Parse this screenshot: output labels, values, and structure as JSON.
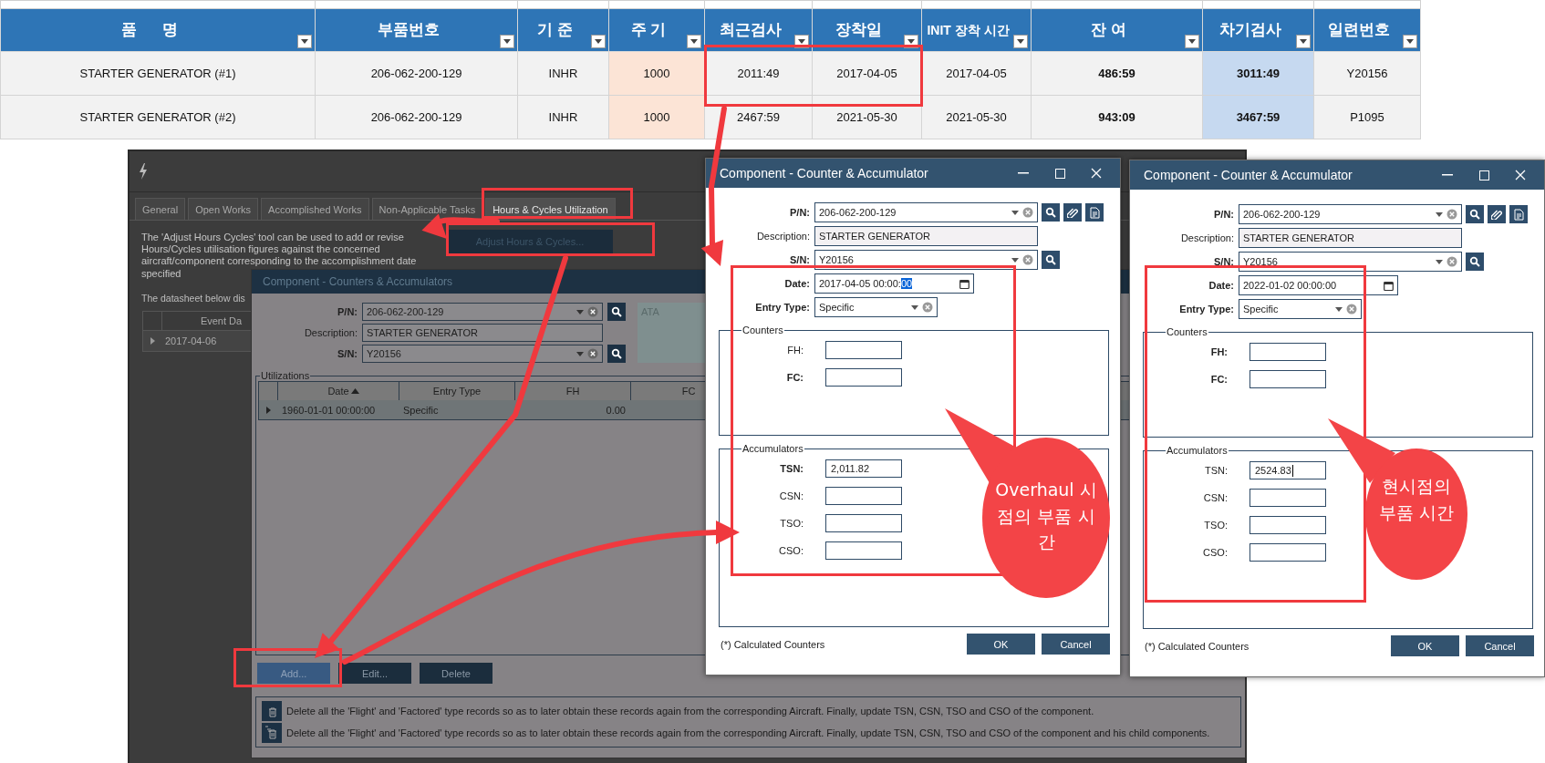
{
  "sheet": {
    "columns": [
      {
        "label": "품      명",
        "kind": "plain",
        "bold": false
      },
      {
        "label": "부품번호",
        "kind": "plain",
        "bold": false
      },
      {
        "label": "기 준",
        "kind": "plain",
        "bold": false
      },
      {
        "label": "주 기",
        "kind": "interval",
        "bold": false
      },
      {
        "label": "최근검사",
        "kind": "plain",
        "bold": false
      },
      {
        "label": "장착일",
        "kind": "plain",
        "bold": false
      },
      {
        "label": "INIT 장착 시간",
        "kind": "plain",
        "bold": false
      },
      {
        "label": "잔 여",
        "kind": "plain",
        "bold": true
      },
      {
        "label": "차기검사",
        "kind": "next",
        "bold": true
      },
      {
        "label": "일련번호",
        "kind": "plain",
        "bold": false
      }
    ],
    "rows": [
      {
        "cells": [
          "STARTER GENERATOR (#1)",
          "206-062-200-129",
          "INHR",
          "1000",
          "2011:49",
          "2017-04-05",
          "2017-04-05",
          "486:59",
          "3011:49",
          "Y20156"
        ]
      },
      {
        "cells": [
          "STARTER GENERATOR (#2)",
          "206-062-200-129",
          "INHR",
          "1000",
          "2467:59",
          "2021-05-30",
          "2021-05-30",
          "943:09",
          "3467:59",
          "P1095"
        ]
      }
    ]
  },
  "main_window": {
    "tabs": [
      {
        "label": "General",
        "selected": false
      },
      {
        "label": "Open Works",
        "selected": false
      },
      {
        "label": "Accomplished  Works",
        "selected": false
      },
      {
        "label": "Non-Applicable Tasks",
        "selected": false
      },
      {
        "label": "Hours & Cycles Utilization",
        "selected": true
      }
    ],
    "intro": "The 'Adjust Hours  Cycles' tool can be used to add or revise Hours/Cycles utilisation figures against the concerned aircraft/component corresponding to the accomplishment date specified",
    "adjust_button": "Adjust Hours & Cycles...",
    "datasheet_note": "The datasheet below dis",
    "grid_column": "Event Da",
    "grid_rows": [
      "2017-04-06"
    ]
  },
  "counters_dialog": {
    "title": "Component - Counters & Accumulators",
    "pn_label": "P/N:",
    "pn": "206-062-200-129",
    "description_label": "Description:",
    "description": "STARTER GENERATOR",
    "sn_label": "S/N:",
    "sn": "Y20156",
    "ata": "ATA",
    "group_title": "Utilizations",
    "columns": [
      {
        "label": "Date",
        "sorted": true
      },
      {
        "label": "Entry Type",
        "sorted": false
      },
      {
        "label": "FH",
        "sorted": false
      },
      {
        "label": "FC",
        "sorted": false
      }
    ],
    "rows": [
      {
        "cells": [
          "1960-01-01 00:00:00",
          "Specific",
          "0.00",
          ""
        ]
      }
    ],
    "buttons": [
      {
        "label": "Add...",
        "highlighted": true
      },
      {
        "label": "Edit...",
        "highlighted": false
      },
      {
        "label": "Delete",
        "highlighted": false
      }
    ],
    "notes": [
      {
        "kind": "single",
        "text": "Delete all the 'Flight' and 'Factored' type records so as to later obtain these records again from the corresponding Aircraft. Finally, update TSN, CSN, TSO and CSO of the component."
      },
      {
        "kind": "tree",
        "text": "Delete all the 'Flight' and 'Factored' type records so as to later obtain these records again from the corresponding Aircraft. Finally, update TSN, CSN, TSO and CSO of the component and his child components."
      }
    ]
  },
  "dialogs": [
    {
      "title": "Component - Counter & Accumulator",
      "pn_label": "P/N:",
      "pn": "206-062-200-129",
      "description_label": "Description:",
      "description": "STARTER GENERATOR",
      "sn_label": "S/N:",
      "sn": "Y20156",
      "date_label": "Date:",
      "date": {
        "value": "2017-04-05 00:00:",
        "selection": "00"
      },
      "entry_label": "Entry Type:",
      "entry_type": "Specific",
      "counters_title": "Counters",
      "counters": [
        {
          "label": "FH:",
          "bold": false,
          "focused": false
        },
        {
          "label": "FC:",
          "bold": true,
          "focused": false
        }
      ],
      "accumulators_title": "Accumulators",
      "accumulators": [
        {
          "label": "TSN:",
          "bold": true,
          "value": "2,011.82",
          "focused": false
        },
        {
          "label": "CSN:",
          "bold": false,
          "focused": false
        },
        {
          "label": "TSO:",
          "bold": false,
          "focused": false
        },
        {
          "label": "CSO:",
          "bold": false,
          "focused": false
        }
      ],
      "footnote": "(*) Calculated Counters",
      "ok": "OK",
      "cancel": "Cancel"
    },
    {
      "title": "Component - Counter & Accumulator",
      "pn_label": "P/N:",
      "pn": "206-062-200-129",
      "description_label": "Description:",
      "description": "STARTER GENERATOR",
      "sn_label": "S/N:",
      "sn": "Y20156",
      "date_label": "Date:",
      "date": {
        "value": "2022-01-02 00:00:00"
      },
      "entry_label": "Entry Type:",
      "entry_type": "Specific",
      "counters_title": "Counters",
      "counters": [
        {
          "label": "FH:",
          "bold": true,
          "focused": false
        },
        {
          "label": "FC:",
          "bold": true,
          "focused": false
        }
      ],
      "accumulators_title": "Accumulators",
      "accumulators": [
        {
          "label": "TSN:",
          "bold": false,
          "value": "2524.83",
          "focused": true
        },
        {
          "label": "CSN:",
          "bold": false,
          "focused": false
        },
        {
          "label": "TSO:",
          "bold": false,
          "focused": false
        },
        {
          "label": "CSO:",
          "bold": false,
          "focused": false
        }
      ],
      "footnote": "(*) Calculated Counters",
      "ok": "OK",
      "cancel": "Cancel"
    }
  ],
  "callouts": [
    {
      "text": "Overhaul 시점의 부품 시간"
    },
    {
      "text": "현시점의 부품 시간"
    }
  ]
}
